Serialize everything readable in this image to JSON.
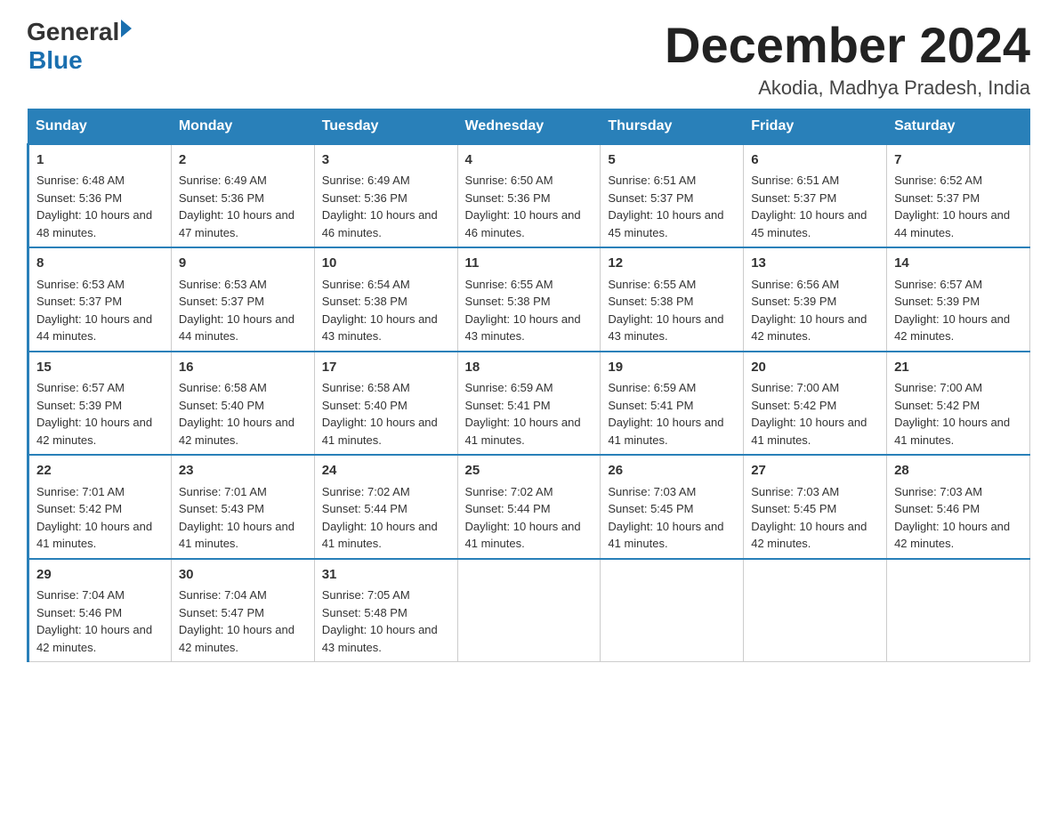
{
  "header": {
    "logo": {
      "general": "General",
      "blue": "Blue",
      "line2": "Blue"
    },
    "title": "December 2024",
    "location": "Akodia, Madhya Pradesh, India"
  },
  "days": [
    "Sunday",
    "Monday",
    "Tuesday",
    "Wednesday",
    "Thursday",
    "Friday",
    "Saturday"
  ],
  "weeks": [
    [
      {
        "date": "1",
        "sunrise": "Sunrise: 6:48 AM",
        "sunset": "Sunset: 5:36 PM",
        "daylight": "Daylight: 10 hours and 48 minutes."
      },
      {
        "date": "2",
        "sunrise": "Sunrise: 6:49 AM",
        "sunset": "Sunset: 5:36 PM",
        "daylight": "Daylight: 10 hours and 47 minutes."
      },
      {
        "date": "3",
        "sunrise": "Sunrise: 6:49 AM",
        "sunset": "Sunset: 5:36 PM",
        "daylight": "Daylight: 10 hours and 46 minutes."
      },
      {
        "date": "4",
        "sunrise": "Sunrise: 6:50 AM",
        "sunset": "Sunset: 5:36 PM",
        "daylight": "Daylight: 10 hours and 46 minutes."
      },
      {
        "date": "5",
        "sunrise": "Sunrise: 6:51 AM",
        "sunset": "Sunset: 5:37 PM",
        "daylight": "Daylight: 10 hours and 45 minutes."
      },
      {
        "date": "6",
        "sunrise": "Sunrise: 6:51 AM",
        "sunset": "Sunset: 5:37 PM",
        "daylight": "Daylight: 10 hours and 45 minutes."
      },
      {
        "date": "7",
        "sunrise": "Sunrise: 6:52 AM",
        "sunset": "Sunset: 5:37 PM",
        "daylight": "Daylight: 10 hours and 44 minutes."
      }
    ],
    [
      {
        "date": "8",
        "sunrise": "Sunrise: 6:53 AM",
        "sunset": "Sunset: 5:37 PM",
        "daylight": "Daylight: 10 hours and 44 minutes."
      },
      {
        "date": "9",
        "sunrise": "Sunrise: 6:53 AM",
        "sunset": "Sunset: 5:37 PM",
        "daylight": "Daylight: 10 hours and 44 minutes."
      },
      {
        "date": "10",
        "sunrise": "Sunrise: 6:54 AM",
        "sunset": "Sunset: 5:38 PM",
        "daylight": "Daylight: 10 hours and 43 minutes."
      },
      {
        "date": "11",
        "sunrise": "Sunrise: 6:55 AM",
        "sunset": "Sunset: 5:38 PM",
        "daylight": "Daylight: 10 hours and 43 minutes."
      },
      {
        "date": "12",
        "sunrise": "Sunrise: 6:55 AM",
        "sunset": "Sunset: 5:38 PM",
        "daylight": "Daylight: 10 hours and 43 minutes."
      },
      {
        "date": "13",
        "sunrise": "Sunrise: 6:56 AM",
        "sunset": "Sunset: 5:39 PM",
        "daylight": "Daylight: 10 hours and 42 minutes."
      },
      {
        "date": "14",
        "sunrise": "Sunrise: 6:57 AM",
        "sunset": "Sunset: 5:39 PM",
        "daylight": "Daylight: 10 hours and 42 minutes."
      }
    ],
    [
      {
        "date": "15",
        "sunrise": "Sunrise: 6:57 AM",
        "sunset": "Sunset: 5:39 PM",
        "daylight": "Daylight: 10 hours and 42 minutes."
      },
      {
        "date": "16",
        "sunrise": "Sunrise: 6:58 AM",
        "sunset": "Sunset: 5:40 PM",
        "daylight": "Daylight: 10 hours and 42 minutes."
      },
      {
        "date": "17",
        "sunrise": "Sunrise: 6:58 AM",
        "sunset": "Sunset: 5:40 PM",
        "daylight": "Daylight: 10 hours and 41 minutes."
      },
      {
        "date": "18",
        "sunrise": "Sunrise: 6:59 AM",
        "sunset": "Sunset: 5:41 PM",
        "daylight": "Daylight: 10 hours and 41 minutes."
      },
      {
        "date": "19",
        "sunrise": "Sunrise: 6:59 AM",
        "sunset": "Sunset: 5:41 PM",
        "daylight": "Daylight: 10 hours and 41 minutes."
      },
      {
        "date": "20",
        "sunrise": "Sunrise: 7:00 AM",
        "sunset": "Sunset: 5:42 PM",
        "daylight": "Daylight: 10 hours and 41 minutes."
      },
      {
        "date": "21",
        "sunrise": "Sunrise: 7:00 AM",
        "sunset": "Sunset: 5:42 PM",
        "daylight": "Daylight: 10 hours and 41 minutes."
      }
    ],
    [
      {
        "date": "22",
        "sunrise": "Sunrise: 7:01 AM",
        "sunset": "Sunset: 5:42 PM",
        "daylight": "Daylight: 10 hours and 41 minutes."
      },
      {
        "date": "23",
        "sunrise": "Sunrise: 7:01 AM",
        "sunset": "Sunset: 5:43 PM",
        "daylight": "Daylight: 10 hours and 41 minutes."
      },
      {
        "date": "24",
        "sunrise": "Sunrise: 7:02 AM",
        "sunset": "Sunset: 5:44 PM",
        "daylight": "Daylight: 10 hours and 41 minutes."
      },
      {
        "date": "25",
        "sunrise": "Sunrise: 7:02 AM",
        "sunset": "Sunset: 5:44 PM",
        "daylight": "Daylight: 10 hours and 41 minutes."
      },
      {
        "date": "26",
        "sunrise": "Sunrise: 7:03 AM",
        "sunset": "Sunset: 5:45 PM",
        "daylight": "Daylight: 10 hours and 41 minutes."
      },
      {
        "date": "27",
        "sunrise": "Sunrise: 7:03 AM",
        "sunset": "Sunset: 5:45 PM",
        "daylight": "Daylight: 10 hours and 42 minutes."
      },
      {
        "date": "28",
        "sunrise": "Sunrise: 7:03 AM",
        "sunset": "Sunset: 5:46 PM",
        "daylight": "Daylight: 10 hours and 42 minutes."
      }
    ],
    [
      {
        "date": "29",
        "sunrise": "Sunrise: 7:04 AM",
        "sunset": "Sunset: 5:46 PM",
        "daylight": "Daylight: 10 hours and 42 minutes."
      },
      {
        "date": "30",
        "sunrise": "Sunrise: 7:04 AM",
        "sunset": "Sunset: 5:47 PM",
        "daylight": "Daylight: 10 hours and 42 minutes."
      },
      {
        "date": "31",
        "sunrise": "Sunrise: 7:05 AM",
        "sunset": "Sunset: 5:48 PM",
        "daylight": "Daylight: 10 hours and 43 minutes."
      },
      null,
      null,
      null,
      null
    ]
  ]
}
